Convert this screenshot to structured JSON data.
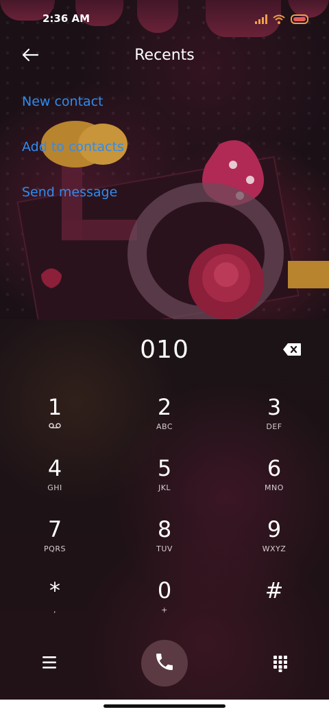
{
  "status_bar": {
    "time": "2:36 AM",
    "icons": [
      "signal-icon",
      "wifi-icon",
      "battery-icon"
    ]
  },
  "header": {
    "title": "Recents",
    "back_icon": "arrow-left-icon"
  },
  "actions": [
    {
      "label": "New contact"
    },
    {
      "label": "Add to contacts"
    },
    {
      "label": "Send message"
    }
  ],
  "dialer": {
    "number": "010",
    "keys": [
      {
        "digit": "1",
        "letters": ""
      },
      {
        "digit": "2",
        "letters": "ABC"
      },
      {
        "digit": "3",
        "letters": "DEF"
      },
      {
        "digit": "4",
        "letters": "GHI"
      },
      {
        "digit": "5",
        "letters": "JKL"
      },
      {
        "digit": "6",
        "letters": "MNO"
      },
      {
        "digit": "7",
        "letters": "PQRS"
      },
      {
        "digit": "8",
        "letters": "TUV"
      },
      {
        "digit": "9",
        "letters": "WXYZ"
      },
      {
        "digit": "*",
        "letters": ","
      },
      {
        "digit": "0",
        "letters": "+"
      },
      {
        "digit": "#",
        "letters": ""
      }
    ]
  },
  "colors": {
    "link": "#2f8cf0",
    "call_button": "#5b3a44",
    "background": "#1d1216"
  }
}
